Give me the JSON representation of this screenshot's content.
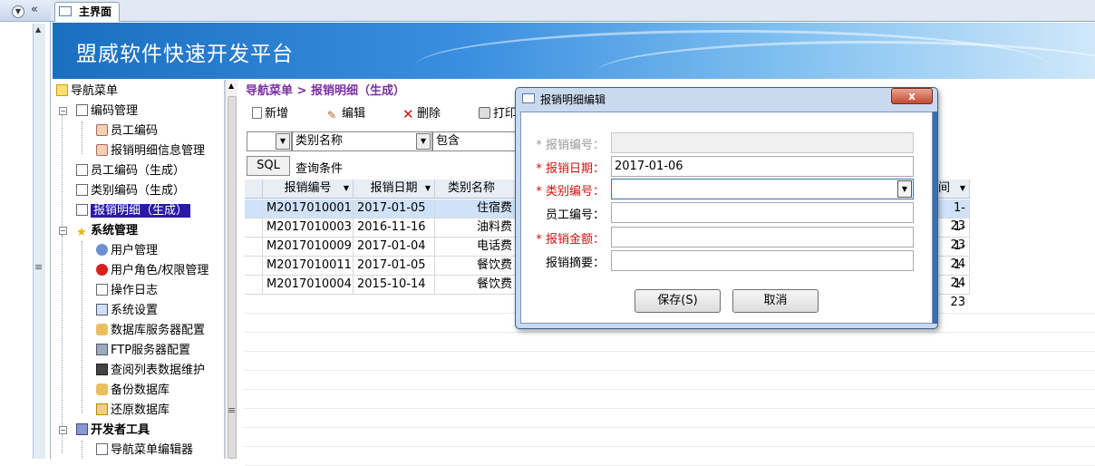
{
  "tab": {
    "label": "主界面"
  },
  "banner": {
    "title": "盟威软件快速开发平台"
  },
  "breadcrumb": "导航菜单 > 报销明细（生成）",
  "tree": [
    {
      "label": "导航菜单",
      "icon": "folder-open-icon",
      "depth": 0,
      "bold": false
    },
    {
      "label": "编码管理",
      "icon": "document-icon",
      "depth": 1,
      "bold": false
    },
    {
      "label": "员工编码",
      "icon": "tools-icon",
      "depth": 2,
      "bold": false
    },
    {
      "label": "报销明细信息管理",
      "icon": "tools-icon",
      "depth": 2,
      "bold": false
    },
    {
      "label": "员工编码（生成）",
      "icon": "document-icon",
      "depth": 1,
      "bold": false
    },
    {
      "label": "类别编码（生成）",
      "icon": "document-icon",
      "depth": 1,
      "bold": false
    },
    {
      "label": "报销明细（生成）",
      "icon": "document-icon",
      "depth": 1,
      "bold": false,
      "selected": true
    },
    {
      "label": "系统管理",
      "icon": "star-icon",
      "depth": 1,
      "bold": true
    },
    {
      "label": "用户管理",
      "icon": "users-icon",
      "depth": 2,
      "bold": false
    },
    {
      "label": "用户角色/权限管理",
      "icon": "stop-icon",
      "depth": 2,
      "bold": false
    },
    {
      "label": "操作日志",
      "icon": "document-icon",
      "depth": 2,
      "bold": false
    },
    {
      "label": "系统设置",
      "icon": "settings-icon",
      "depth": 2,
      "bold": false
    },
    {
      "label": "数据库服务器配置",
      "icon": "database-icon",
      "depth": 2,
      "bold": false
    },
    {
      "label": "FTP服务器配置",
      "icon": "server-icon",
      "depth": 2,
      "bold": false
    },
    {
      "label": "查阅列表数据维护",
      "icon": "list-icon",
      "depth": 2,
      "bold": false
    },
    {
      "label": "备份数据库",
      "icon": "database-icon",
      "depth": 2,
      "bold": false
    },
    {
      "label": "还原数据库",
      "icon": "restore-icon",
      "depth": 2,
      "bold": false
    },
    {
      "label": "开发者工具",
      "icon": "devtools-icon",
      "depth": 1,
      "bold": true
    },
    {
      "label": "导航菜单编辑器",
      "icon": "edit-icon",
      "depth": 2,
      "bold": false
    }
  ],
  "toolbar": {
    "new": "新增",
    "edit": "编辑",
    "delete": "删除",
    "print": "打印"
  },
  "filter": {
    "field": "类别名称",
    "op": "包含",
    "sql": "SQL",
    "query_label": "查询条件"
  },
  "grid": {
    "headers": [
      "报销编号",
      "报销日期",
      "类别名称"
    ],
    "right_header": "间",
    "rows": [
      {
        "id": "M2017010001",
        "date": "2017-01-05",
        "cat": "住宿费",
        "tail": "1-23"
      },
      {
        "id": "M2017010003",
        "date": "2016-11-16",
        "cat": "油料费",
        "tail": "1-23"
      },
      {
        "id": "M2017010009",
        "date": "2017-01-04",
        "cat": "电话费",
        "tail": "1-24"
      },
      {
        "id": "M2017010011",
        "date": "2017-01-05",
        "cat": "餐饮费",
        "tail": "1-24"
      },
      {
        "id": "M2017010004",
        "date": "2015-10-14",
        "cat": "餐饮费",
        "tail": "1-23"
      }
    ]
  },
  "dialog": {
    "title": "报销明细编辑",
    "close": "x",
    "fields": [
      {
        "label": "* 报销编号：",
        "value": "",
        "state": "disabled"
      },
      {
        "label": "* 报销日期：",
        "value": "2017-01-06",
        "state": "required"
      },
      {
        "label": "* 类别编号：",
        "value": "",
        "state": "required"
      },
      {
        "label": "员工编号：",
        "value": "",
        "state": "normal"
      },
      {
        "label": "* 报销金额：",
        "value": "",
        "state": "required"
      },
      {
        "label": "报销摘要：",
        "value": "",
        "state": "normal"
      }
    ],
    "save": "保存(S)",
    "cancel": "取消"
  }
}
